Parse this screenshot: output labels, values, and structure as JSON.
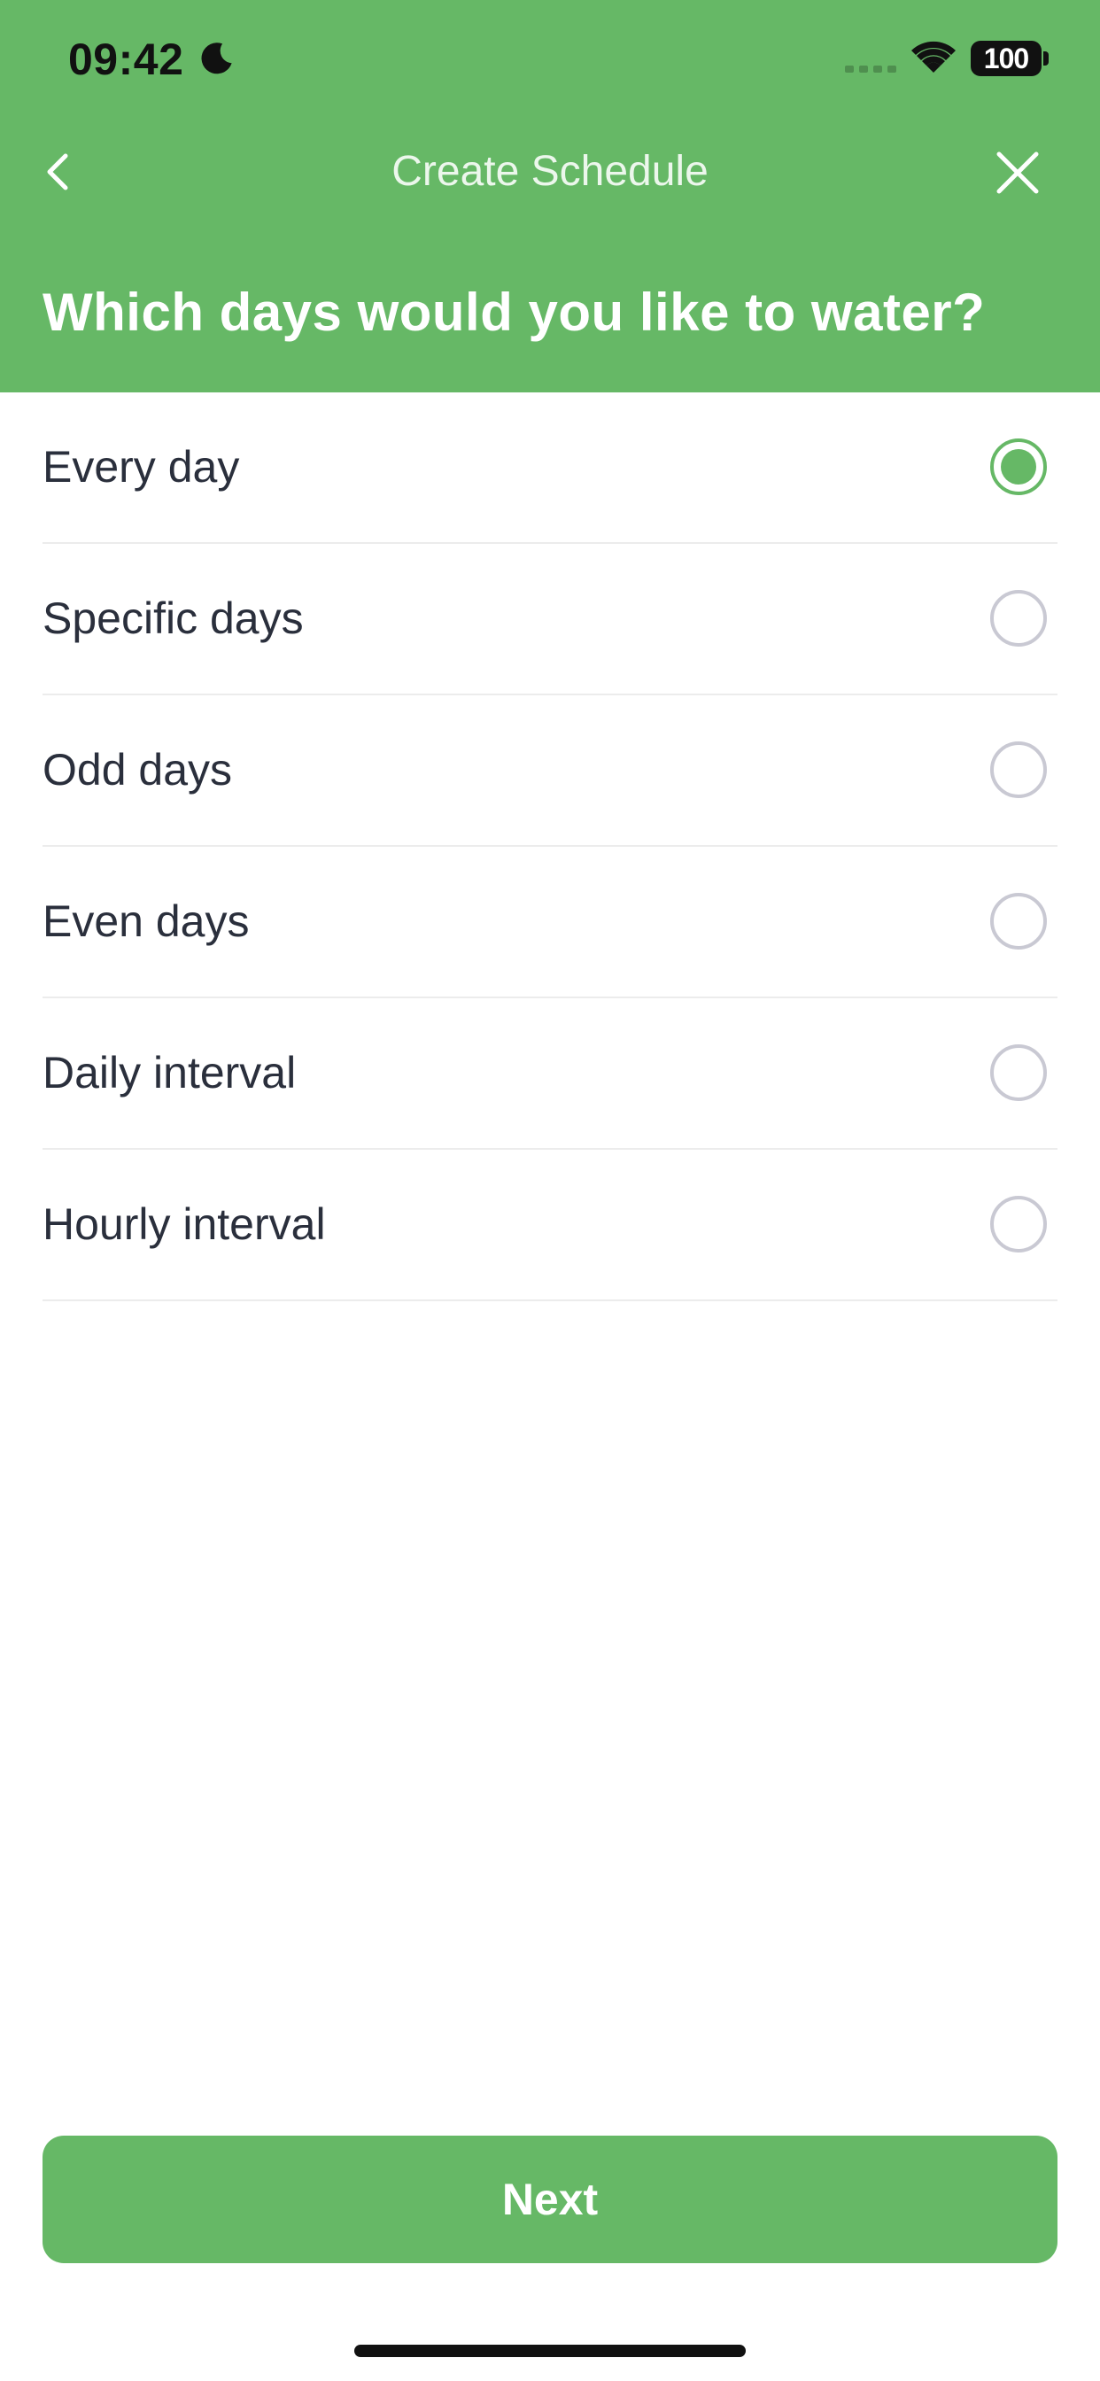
{
  "status_bar": {
    "time": "09:42",
    "battery": "100",
    "icons": [
      "moon-icon",
      "signal-icon",
      "wifi-icon",
      "battery-icon"
    ]
  },
  "nav": {
    "title": "Create Schedule",
    "back_icon": "chevron-left-icon",
    "close_icon": "close-icon"
  },
  "question": "Which days would you like to water?",
  "options": [
    {
      "label": "Every day",
      "selected": true
    },
    {
      "label": "Specific days",
      "selected": false
    },
    {
      "label": "Odd days",
      "selected": false
    },
    {
      "label": "Even days",
      "selected": false
    },
    {
      "label": "Daily interval",
      "selected": false
    },
    {
      "label": "Hourly interval",
      "selected": false
    }
  ],
  "next_button": {
    "label": "Next"
  },
  "colors": {
    "accent": "#66b866",
    "text": "#2a2f3c",
    "radio_unselected": "#c9c9d3",
    "divider": "#ececec"
  }
}
